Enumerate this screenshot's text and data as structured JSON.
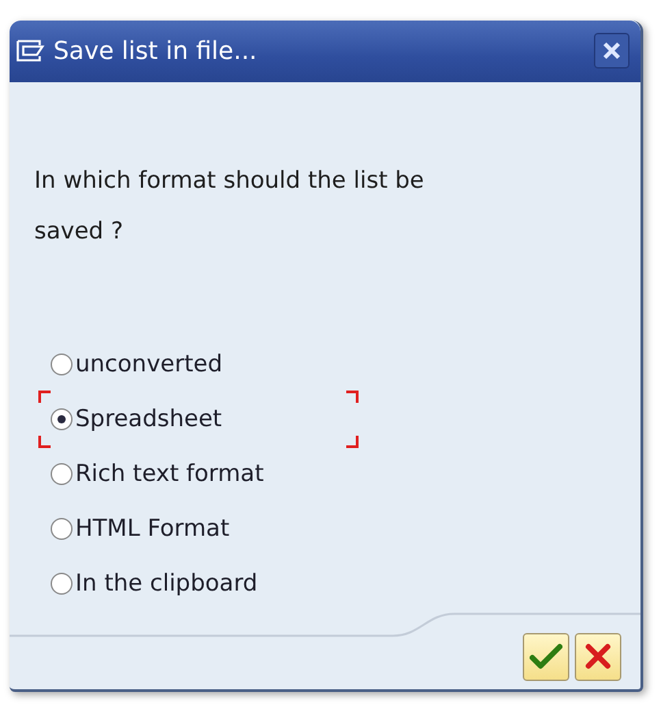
{
  "window": {
    "title": "Save list in file..."
  },
  "question": "In which format should the list be saved ?",
  "options": [
    {
      "label": "unconverted",
      "selected": false,
      "focused": false
    },
    {
      "label": "Spreadsheet",
      "selected": true,
      "focused": true
    },
    {
      "label": "Rich text format",
      "selected": false,
      "focused": false
    },
    {
      "label": "HTML Format",
      "selected": false,
      "focused": false
    },
    {
      "label": "In the clipboard",
      "selected": false,
      "focused": false
    }
  ]
}
